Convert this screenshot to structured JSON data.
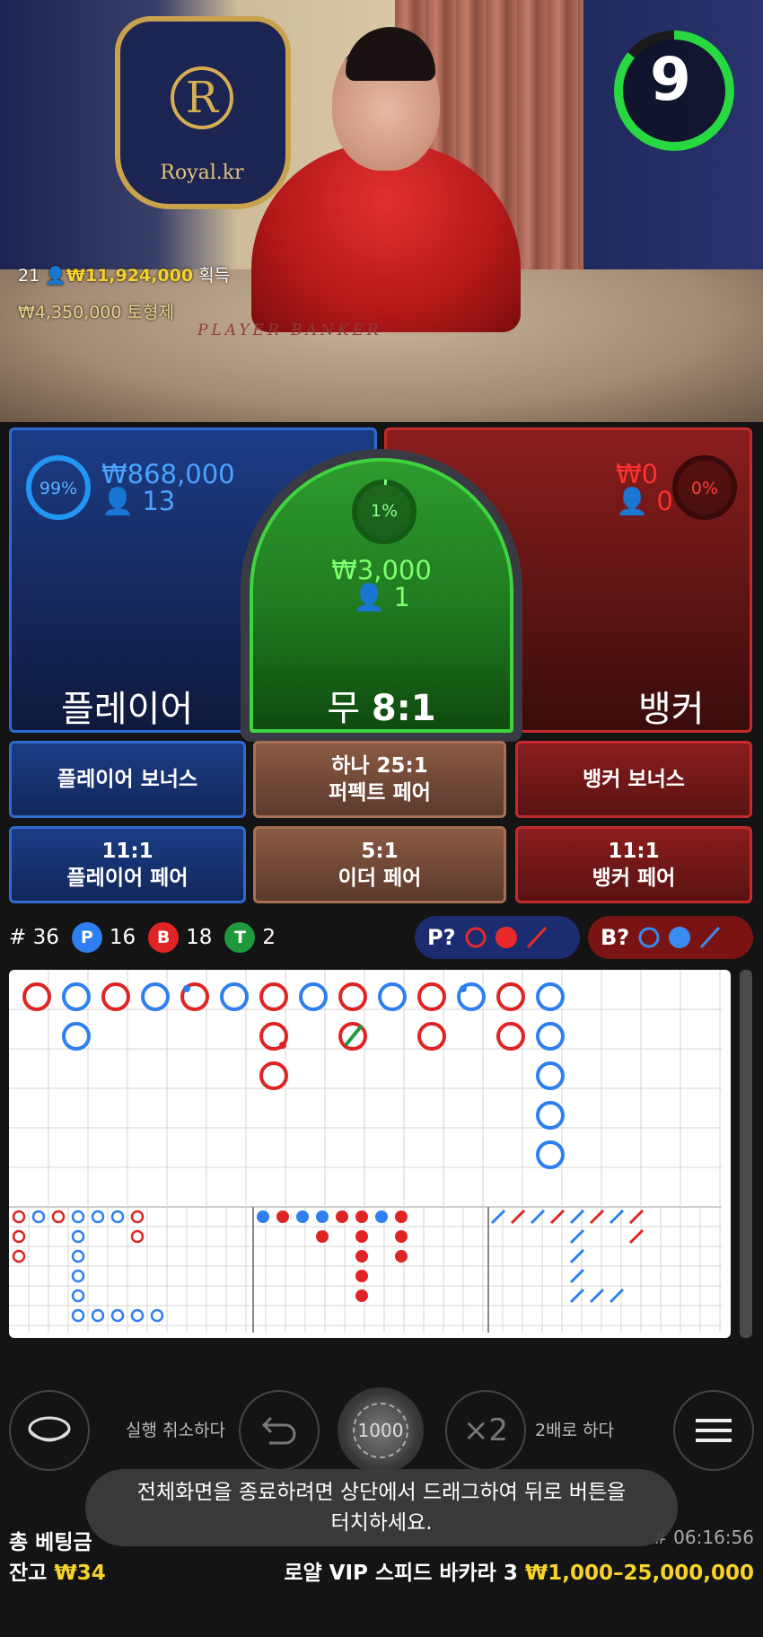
{
  "video": {
    "logo_letter": "R",
    "logo_text": "Royal.kr",
    "table_text": "PLAYER   BANKER",
    "winners_count": "21",
    "win_amount": "₩11,924,000",
    "win_label": "획득",
    "bet_amount": "₩4,350,000",
    "bet_label": "토형제",
    "countdown": "9"
  },
  "bets": {
    "player": {
      "pct": "99%",
      "amount": "₩868,000",
      "players": "13",
      "label": "플레이어"
    },
    "tie": {
      "pct": "1%",
      "amount": "₩3,000",
      "players": "1",
      "label_prefix": "무",
      "odds": "8:1"
    },
    "banker": {
      "pct": "0%",
      "amount": "₩0",
      "players": "0",
      "label": "뱅커"
    }
  },
  "side_bets": {
    "player_bonus": "플레이어 보너스",
    "perfect_pair_odds": "하나 25:1",
    "perfect_pair": "퍼펙트 페어",
    "banker_bonus": "뱅커 보너스",
    "player_pair_odds": "11:1",
    "player_pair": "플레이어 페어",
    "either_pair_odds": "5:1",
    "either_pair": "이더 페어",
    "banker_pair_odds": "11:1",
    "banker_pair": "뱅커 페어"
  },
  "stats": {
    "round": "# 36",
    "p_badge": "P",
    "p_count": "16",
    "b_badge": "B",
    "b_count": "18",
    "t_badge": "T",
    "t_count": "2",
    "p_predict": "P?",
    "b_predict": "B?"
  },
  "controls": {
    "undo_label": "실행 취소하다",
    "chip_value": "1000",
    "double_symbol": "×2",
    "double_label": "2배로 하다"
  },
  "toast": {
    "line1": "전체화면을 종료하려면 상단에서 드래그하여 뒤로 버튼을",
    "line2": "터치하세요."
  },
  "footer": {
    "total_bet_label": "총 베팅금",
    "balance_label": "잔고",
    "balance_value": "₩34",
    "time": "# 06:16:56",
    "table_name": "로얄 VIP 스피드 바카라 3",
    "limits": "₩1,000–25,000,000"
  },
  "colors": {
    "player": "#2e6bd0",
    "banker": "#d42a2a",
    "tie": "#28a83c",
    "gold": "#f6d22a"
  }
}
